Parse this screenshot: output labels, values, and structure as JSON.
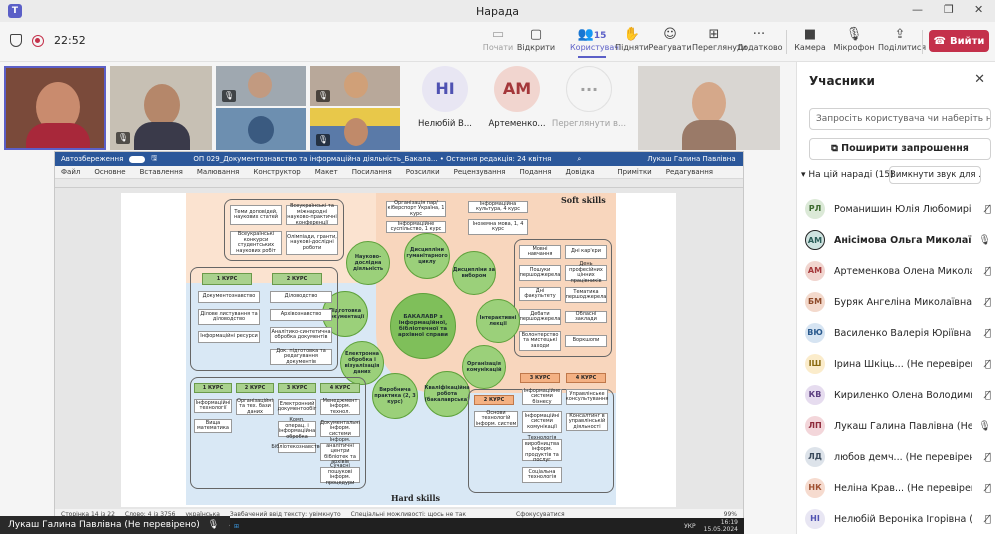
{
  "window": {
    "title": "Нарада"
  },
  "toolbar": {
    "timer": "22:52",
    "buttons": [
      {
        "label": "Почати",
        "icon": "screen-icon",
        "state": "disabled"
      },
      {
        "label": "Відкрити",
        "icon": "chat-icon",
        "state": "normal"
      },
      {
        "label": "Користувачі",
        "count": "15",
        "icon": "people-icon",
        "state": "active"
      },
      {
        "label": "Підняти",
        "icon": "hand-icon",
        "state": "normal"
      },
      {
        "label": "Реагувати",
        "icon": "smile-icon",
        "state": "normal"
      },
      {
        "label": "Переглянути",
        "icon": "grid-icon",
        "state": "normal"
      },
      {
        "label": "Додатково",
        "icon": "more-icon",
        "state": "normal"
      },
      {
        "label": "Камера",
        "icon": "camera-icon",
        "state": "normal"
      },
      {
        "label": "Мікрофон",
        "icon": "mic-off-icon",
        "state": "normal"
      },
      {
        "label": "Поділитися",
        "icon": "share-icon",
        "state": "normal"
      }
    ],
    "leave": "Вийти"
  },
  "tiles": [
    {
      "initials": "НІ",
      "name": "Нелюбій В...",
      "bg": "#e8e6f3",
      "fg": "#4f52b2"
    },
    {
      "initials": "АМ",
      "name": "Артеменко...",
      "bg": "#f1d5cf",
      "fg": "#a4373a"
    },
    {
      "initials": "···",
      "name": "Переглянути в...",
      "bg": "#f5f5f5",
      "fg": "#a0a0a0"
    }
  ],
  "panel": {
    "title": "Учасники",
    "invite_placeholder": "Запросіть користувача чи наберіть н",
    "share_invite": "Поширити запрошення",
    "in_meeting": "На цій нараді (15)",
    "mute_all": "Вимкнути звук для ...",
    "participants": [
      {
        "initials": "РЛ",
        "name": "Романишин Юлія Любомирі...",
        "bg": "#dbe9d7",
        "fg": "#3b6a2e",
        "muted": true
      },
      {
        "initials": "АМ",
        "name": "Анісімова Ольга Миколаївн...",
        "bg": "#cfe3e0",
        "fg": "#2a5c57",
        "muted": false,
        "bold": true
      },
      {
        "initials": "АМ",
        "name": "Артеменкова Олена Миколаї...",
        "bg": "#f1d5cf",
        "fg": "#a4373a",
        "muted": true
      },
      {
        "initials": "БМ",
        "name": "Буряк Ангеліна Миколаївна (...",
        "bg": "#f3d9cc",
        "fg": "#8e4a2a",
        "muted": true
      },
      {
        "initials": "ВЮ",
        "name": "Василенко Валерія Юріївна (...",
        "bg": "#d6e4f2",
        "fg": "#2a5a8e",
        "muted": true
      },
      {
        "initials": "ІШ",
        "name": "Ірина Шкіць...  (Не перевірено)",
        "bg": "#fbeccb",
        "fg": "#8a6a10",
        "muted": true
      },
      {
        "initials": "КВ",
        "name": "Кириленко Олена Володими...",
        "bg": "#e6dcef",
        "fg": "#5c3f80",
        "muted": true
      },
      {
        "initials": "ЛП",
        "name": "Лукаш Галина Павлівна (Не п...",
        "bg": "#f3d6da",
        "fg": "#8e2a3a",
        "muted": false
      },
      {
        "initials": "ЛД",
        "name": "любов демч...  (Не перевірено)",
        "bg": "#dde3ea",
        "fg": "#3a4a5c",
        "muted": true
      },
      {
        "initials": "НК",
        "name": "Неліна Крав...  (Не перевірено)",
        "bg": "#f6dbcf",
        "fg": "#a05030",
        "muted": true
      },
      {
        "initials": "НІ",
        "name": "Нелюбій Вероніка Ігорівна (...",
        "bg": "#e8e6f3",
        "fg": "#4f52b2",
        "muted": true
      }
    ]
  },
  "word": {
    "autosave": "Автозбереження",
    "doc_title": "ОП 029_Документознавство та інформаційна діяльність_Бакала... • Остання редакція: 24 квітня",
    "user": "Лукаш Галина Павлівна",
    "menu": [
      "Файл",
      "Основне",
      "Вставлення",
      "Малювання",
      "Конструктор",
      "Макет",
      "Посилання",
      "Розсилки",
      "Рецензування",
      "Подання",
      "Довідка"
    ],
    "notes": "Примітки",
    "editing": "Редагування",
    "status": [
      "Сторінка 14 із 22",
      "Слово: 4 із 3756",
      "українська",
      "Завбачений ввід тексту: увімкнуто",
      "Спеціальні можливості: щось не так",
      "Сфокусуватися"
    ],
    "zoom": "99%"
  },
  "diagram": {
    "soft": "Soft skills",
    "hard": "Hard skills",
    "center": "БАКАЛАВР з інформаційної, бібліотечної та архівної справи",
    "top_boxes": [
      "Теми доповідей, наукових статей",
      "Всеукраїнські та міжнародні науково-практичні конференції",
      "Всеукраїнські конкурси студентських наукових робіт",
      "Олімпіади, гранти, наукові-дослідні роботи"
    ],
    "soft_boxes": [
      "Організація пар/кіберспорт Україна, 1 курс",
      "Інформаційна культура, 4 курс",
      "Інформаційне суспільство, 1 курс",
      "Іноземна мова, 1, 4 курс"
    ],
    "right_boxes": [
      "Мовні навчання",
      "Дні кар'єри",
      "Пошуки першоджерела",
      "День професійних цінних працівників",
      "Дні факультету",
      "Тематика першоджерела",
      "Дебати першоджерела",
      "Обласні заклади",
      "Волонтерство та мистецькі заходи",
      "Воркшопи"
    ],
    "circles": [
      "Науково-дослідна діяльність",
      "Дисципліни гуманітарного циклу",
      "Дисципліни за вибором",
      "Підготовка документації",
      "Інтерактивні лекції",
      "Електронна обробка і візуалізація даних",
      "Організація комунікацій",
      "Виробнича практика (2, 3 курс)",
      "Кваліфікаційна робота (бакалаврська)"
    ],
    "course1": "1 КУРС",
    "course2": "2 КУРС",
    "course3": "3 КУРС",
    "course4": "4 КУРС",
    "left_boxes": [
      "Документознавство",
      "Ділове листування та діловодство",
      "Інформаційні ресурси",
      "Діловодство",
      "Архівознавство",
      "Аналітико-синтетична обробка документів",
      "Док. підготовка та редагування документів"
    ],
    "bottom_boxes": [
      "Інформаційні технології",
      "Вища математика",
      "Організаційні та тех. бази даних",
      "Електронний документообіг",
      "Комп. операц. і інформаційна обробка",
      "Бібліотекознавство",
      "Менеджмент інформ. технол.",
      "Документальні інформ. системи",
      "Інформ. аналітичні центри бібліотек та архівів",
      "Сучасні пошукові інформ. процедури"
    ],
    "right_bottom": [
      "Основи технологій інформ. систем",
      "Інформаційне системи бізнесу",
      "Інформаційні системи комунікації",
      "Технологія виробництва інформ. продуктів та послуг",
      "Соціальна технологія",
      "Управлінське консультування",
      "Консалтинг в управлінській діяльності"
    ]
  },
  "bottom": {
    "presenter": "Лукаш Галина Павлівна (Не перевірено)",
    "lang": "УКР",
    "time": "16:19",
    "date": "15.05.2024"
  }
}
